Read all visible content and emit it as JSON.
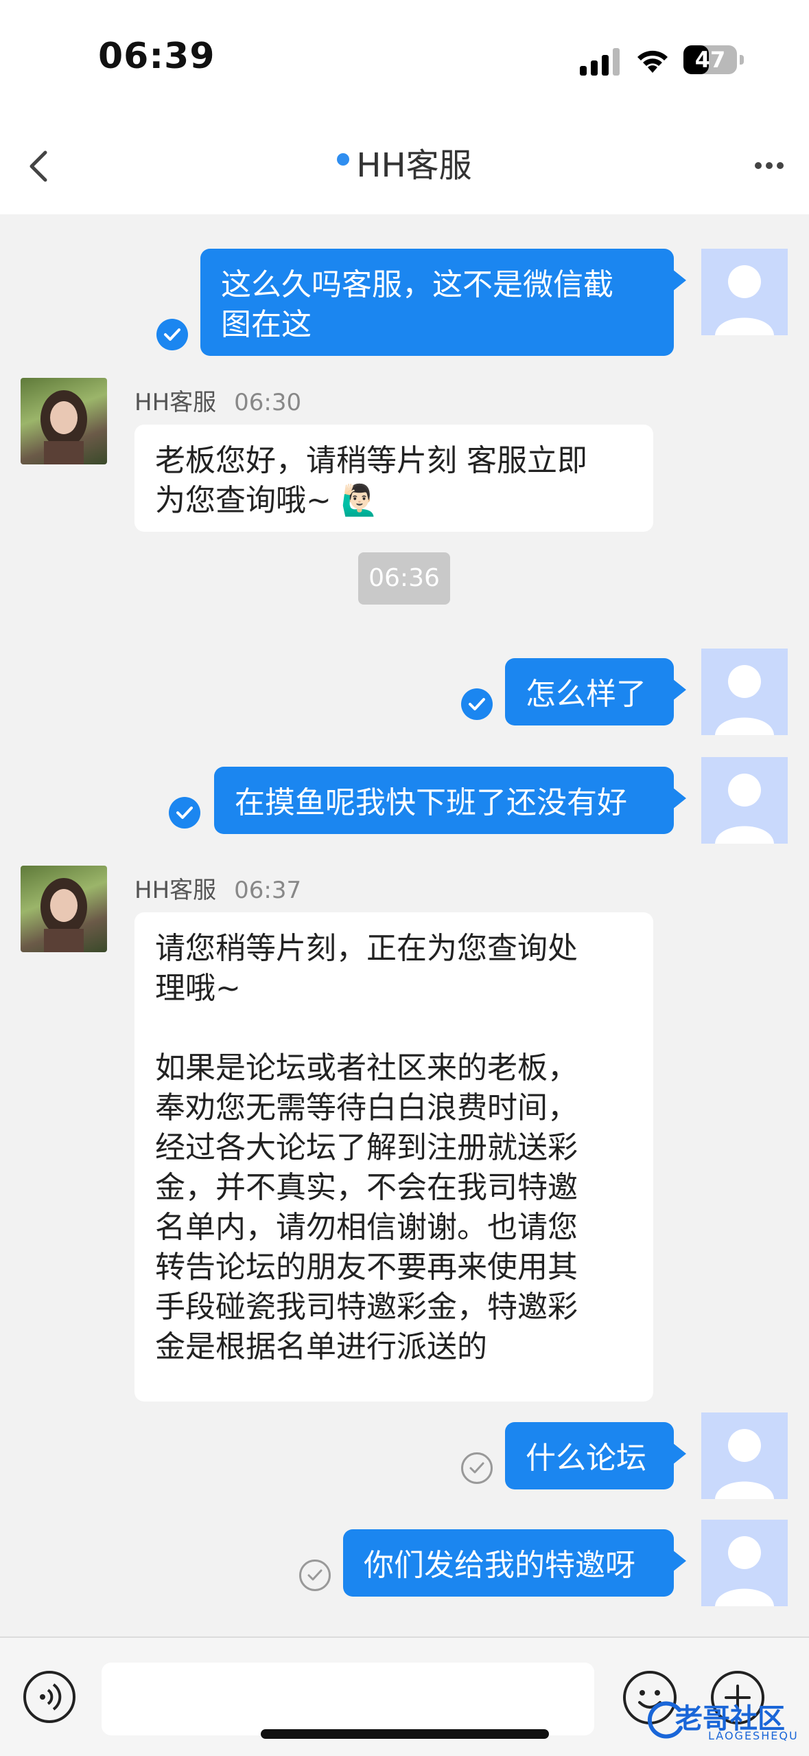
{
  "status_bar": {
    "time": "06:39",
    "battery": "47",
    "battery_level": 0.47
  },
  "header": {
    "title": "HH客服"
  },
  "messages": [
    {
      "dir": "out",
      "text": "这么久吗客服，这不是微信截\n图在这",
      "read": true
    },
    {
      "dir": "in",
      "sender": "HH客服",
      "time": "06:30",
      "text": "老板您好，请稍等片刻 客服立即\n为您查询哦~ 🙋🏻‍♂️"
    },
    {
      "dir": "time",
      "text": "06:36"
    },
    {
      "dir": "out",
      "text": "怎么样了",
      "read": true
    },
    {
      "dir": "out",
      "text": "在摸鱼呢我快下班了还没有好",
      "read": true
    },
    {
      "dir": "in",
      "sender": "HH客服",
      "time": "06:37",
      "text": "请您稍等片刻，正在为您查询处\n理哦~\n\n如果是论坛或者社区来的老板，\n奉劝您无需等待白白浪费时间，\n经过各大论坛了解到注册就送彩\n金，并不真实，不会在我司特邀\n名单内，请勿相信谢谢。也请您\n转告论坛的朋友不要再来使用其\n手段碰瓷我司特邀彩金，特邀彩\n金是根据名单进行派送的"
    },
    {
      "dir": "out",
      "text": "什么论坛",
      "read": false
    },
    {
      "dir": "out",
      "text": "你们发给我的特邀呀",
      "read": false
    }
  ],
  "input_bar": {
    "voice_icon": "voice-icon",
    "emoji_icon": "emoji-icon",
    "plus_icon": "plus-icon",
    "text": ""
  },
  "watermark": {
    "text": "老哥社区",
    "sub": "LAOGESHEQU"
  },
  "colors": {
    "accent": "#1b86f0",
    "user_avatar": "#c9d9fc",
    "background": "#f2f2f2"
  }
}
